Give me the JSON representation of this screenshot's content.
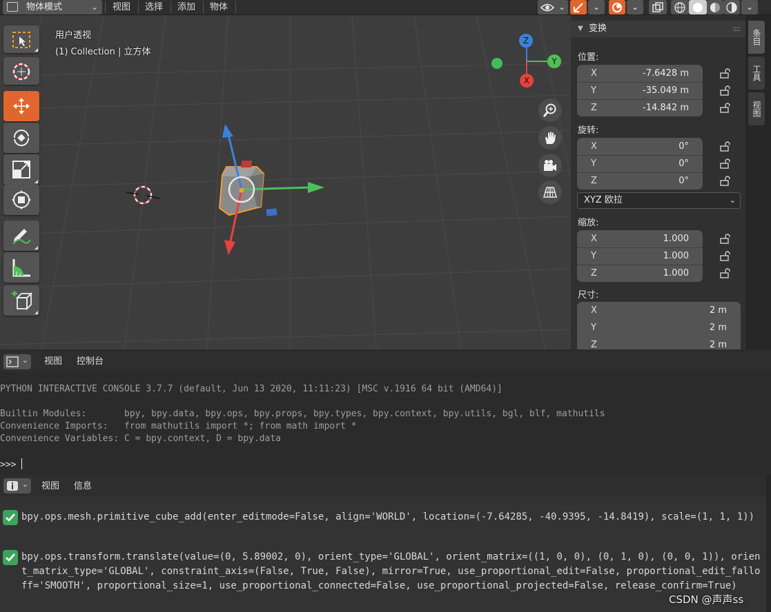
{
  "header": {
    "mode": "物体模式",
    "menus": [
      "视图",
      "选择",
      "添加",
      "物体"
    ]
  },
  "overlay": {
    "view_name": "用户透视",
    "collection": "(1) Collection | 立方体"
  },
  "gizmo": {
    "z": "Z",
    "y": "Y",
    "x": "X"
  },
  "transform_panel": {
    "title": "变换",
    "location_label": "位置:",
    "location": [
      {
        "axis": "X",
        "value": "-7.6428 m"
      },
      {
        "axis": "Y",
        "value": "-35.049 m"
      },
      {
        "axis": "Z",
        "value": "-14.842 m"
      }
    ],
    "rotation_label": "旋转:",
    "rotation": [
      {
        "axis": "X",
        "value": "0°"
      },
      {
        "axis": "Y",
        "value": "0°"
      },
      {
        "axis": "Z",
        "value": "0°"
      }
    ],
    "rotation_mode": "XYZ 欧拉",
    "scale_label": "缩放:",
    "scale": [
      {
        "axis": "X",
        "value": "1.000"
      },
      {
        "axis": "Y",
        "value": "1.000"
      },
      {
        "axis": "Z",
        "value": "1.000"
      }
    ],
    "dimensions_label": "尺寸:",
    "dimensions": [
      {
        "axis": "X",
        "value": "2 m"
      },
      {
        "axis": "Y",
        "value": "2 m"
      },
      {
        "axis": "Z",
        "value": "2 m"
      }
    ]
  },
  "side_tabs": [
    "条目",
    "工具",
    "视图"
  ],
  "console": {
    "menus": [
      "视图",
      "控制台"
    ],
    "banner": "PYTHON INTERACTIVE CONSOLE 3.7.7 (default, Jun 13 2020, 11:11:23) [MSC v.1916 64 bit (AMD64)]",
    "line1": "Builtin Modules:       bpy, bpy.data, bpy.ops, bpy.props, bpy.types, bpy.context, bpy.utils, bgl, blf, mathutils",
    "line2": "Convenience Imports:   from mathutils import *; from math import *",
    "line3": "Convenience Variables: C = bpy.context, D = bpy.data",
    "prompt": ">>> "
  },
  "info": {
    "menus": [
      "视图",
      "信息"
    ],
    "reports": [
      "bpy.ops.mesh.primitive_cube_add(enter_editmode=False, align='WORLD', location=(-7.64285, -40.9395, -14.8419), scale=(1, 1, 1))",
      "bpy.ops.transform.translate(value=(0, 5.89002, 0), orient_type='GLOBAL', orient_matrix=((1, 0, 0), (0, 1, 0), (0, 0, 1)), orient_matrix_type='GLOBAL', constraint_axis=(False, True, False), mirror=True, use_proportional_edit=False, proportional_edit_falloff='SMOOTH', proportional_size=1, use_proportional_connected=False, use_proportional_projected=False, release_confirm=True)"
    ]
  },
  "watermark": "CSDN @声声ss",
  "colors": {
    "accent": "#e0662e",
    "success": "#3ea35a",
    "x_axis": "#e8413e",
    "y_axis": "#4fbf59",
    "z_axis": "#3d82d8"
  }
}
